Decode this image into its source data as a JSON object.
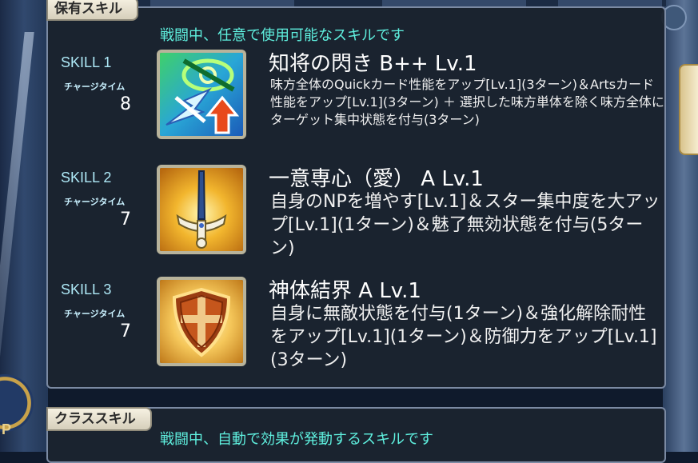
{
  "window": {
    "corner_badge": "P"
  },
  "colors": {
    "panel_bg": "#1b2330",
    "panel_border": "#7b8aa3",
    "subtitle": "#5ff0df",
    "skill_number": "#aee9f7",
    "text": "#ffffff",
    "tab_bg": "#eee8d6"
  },
  "owned_skills": {
    "tab_label": "保有スキル",
    "subtitle": "戦闘中、任意で使用可能なスキルです",
    "skills": [
      {
        "number_label": "SKILL 1",
        "charge_label": "チャージタイム",
        "charge_value": "8",
        "icon": "quick-arts-up-target-focus-icon",
        "name": "知将の閃き B++ Lv.1",
        "description": "味方全体のQuickカード性能をアップ[Lv.1](3ターン)＆Artsカード性能をアップ[Lv.1](3ターン) ＋ 選択した味方単体を除く味方全体にターゲット集中状態を付与(3ターン)"
      },
      {
        "number_label": "SKILL 2",
        "charge_label": "チャージタイム",
        "charge_value": "7",
        "icon": "sword-np-gain-icon",
        "name": "一意専心（愛） A Lv.1",
        "description": "自身のNPを増やす[Lv.1]＆スター集中度を大アップ[Lv.1](1ターン)＆魅了無効状態を付与(5ターン)"
      },
      {
        "number_label": "SKILL 3",
        "charge_label": "チャージタイム",
        "charge_value": "7",
        "icon": "shield-invincible-icon",
        "name": "神体結界 A Lv.1",
        "description": "自身に無敵状態を付与(1ターン)＆強化解除耐性をアップ[Lv.1](1ターン)＆防御力をアップ[Lv.1](3ターン)"
      }
    ]
  },
  "class_skills": {
    "tab_label": "クラススキル",
    "subtitle": "戦闘中、自動で効果が発動するスキルです"
  }
}
